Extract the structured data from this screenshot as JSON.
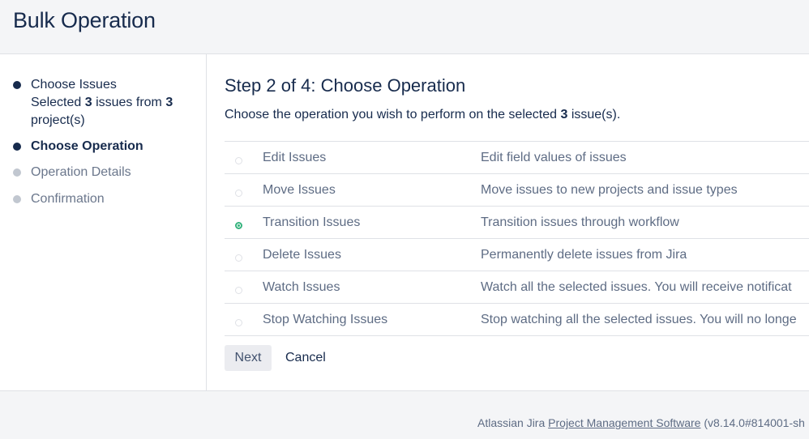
{
  "header": {
    "title": "Bulk Operation"
  },
  "sidebar": {
    "steps": [
      {
        "label": "Choose Issues",
        "state": "done"
      },
      {
        "label": "Choose Operation",
        "state": "current"
      },
      {
        "label": "Operation Details",
        "state": "pending"
      },
      {
        "label": "Confirmation",
        "state": "pending"
      }
    ],
    "summary": {
      "prefix": "Selected ",
      "issue_count": "3",
      "middle": " issues from ",
      "project_count": "3",
      "suffix": " project(s)"
    }
  },
  "main": {
    "title": "Step 2 of 4: Choose Operation",
    "intro": {
      "prefix": "Choose the operation you wish to perform on the selected ",
      "count": "3",
      "suffix": " issue(s)."
    },
    "operations": [
      {
        "name": "Edit Issues",
        "description": "Edit field values of issues",
        "selected": false
      },
      {
        "name": "Move Issues",
        "description": "Move issues to new projects and issue types",
        "selected": false
      },
      {
        "name": "Transition Issues",
        "description": "Transition issues through workflow",
        "selected": true
      },
      {
        "name": "Delete Issues",
        "description": "Permanently delete issues from Jira",
        "selected": false
      },
      {
        "name": "Watch Issues",
        "description": "Watch all the selected issues. You will receive notificat",
        "selected": false
      },
      {
        "name": "Stop Watching Issues",
        "description": "Stop watching all the selected issues. You will no longe",
        "selected": false
      }
    ],
    "next_label": "Next",
    "cancel_label": "Cancel"
  },
  "footer": {
    "prefix": "Atlassian Jira ",
    "link": "Project Management Software",
    "suffix": " (v8.14.0#814001-sh"
  },
  "colors": {
    "accent_green": "#36b37e",
    "text_dark": "#172b4d",
    "text_muted": "#5e6c84"
  }
}
